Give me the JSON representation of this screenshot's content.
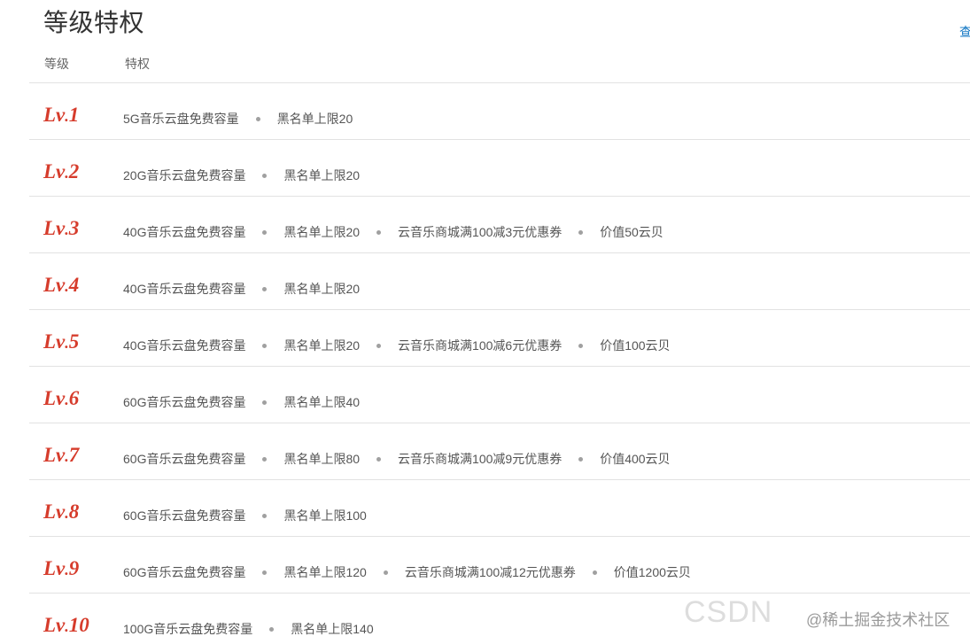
{
  "header": {
    "title": "等级特权",
    "more_link": "查"
  },
  "columns": {
    "level": "等级",
    "privilege": "特权"
  },
  "levels": [
    {
      "lv": "Lv",
      "num": "1",
      "privileges": [
        "5G音乐云盘免费容量",
        "黑名单上限20"
      ]
    },
    {
      "lv": "Lv",
      "num": "2",
      "privileges": [
        "20G音乐云盘免费容量",
        "黑名单上限20"
      ]
    },
    {
      "lv": "Lv",
      "num": "3",
      "privileges": [
        "40G音乐云盘免费容量",
        "黑名单上限20",
        "云音乐商城满100减3元优惠券",
        "价值50云贝"
      ]
    },
    {
      "lv": "Lv",
      "num": "4",
      "privileges": [
        "40G音乐云盘免费容量",
        "黑名单上限20"
      ]
    },
    {
      "lv": "Lv",
      "num": "5",
      "privileges": [
        "40G音乐云盘免费容量",
        "黑名单上限20",
        "云音乐商城满100减6元优惠券",
        "价值100云贝"
      ]
    },
    {
      "lv": "Lv",
      "num": "6",
      "privileges": [
        "60G音乐云盘免费容量",
        "黑名单上限40"
      ]
    },
    {
      "lv": "Lv",
      "num": "7",
      "privileges": [
        "60G音乐云盘免费容量",
        "黑名单上限80",
        "云音乐商城满100减9元优惠券",
        "价值400云贝"
      ]
    },
    {
      "lv": "Lv",
      "num": "8",
      "privileges": [
        "60G音乐云盘免费容量",
        "黑名单上限100"
      ]
    },
    {
      "lv": "Lv",
      "num": "9",
      "privileges": [
        "60G音乐云盘免费容量",
        "黑名单上限120",
        "云音乐商城满100减12元优惠券",
        "价值1200云贝"
      ]
    },
    {
      "lv": "Lv",
      "num": "10",
      "privileges": [
        "100G音乐云盘免费容量",
        "黑名单上限140"
      ]
    }
  ],
  "watermark": {
    "brand": "CSDN",
    "site": "@稀土掘金技术社区"
  },
  "colors": {
    "level_red": "#d63c2c",
    "link_blue": "#0c73c2",
    "divider": "#e2e2e2"
  }
}
